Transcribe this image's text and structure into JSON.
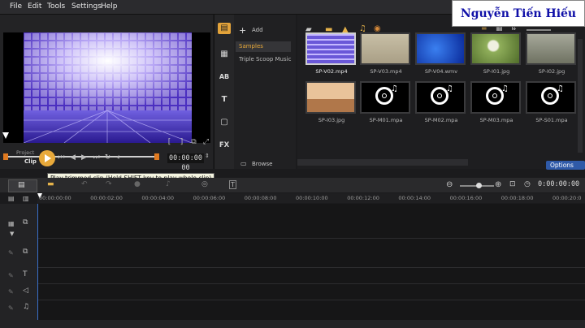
{
  "menu": [
    "File",
    "Edit",
    "Tools",
    "Settings",
    "Help"
  ],
  "watermark": "Nguyễn Tiến Hiếu",
  "preview": {
    "project_label": "Project",
    "clip_label": "Clip",
    "timecode": "00:00:00 00",
    "tooltip": "Play trimmed clip (Hold SHIFT key to play whole clip)"
  },
  "library": {
    "add_label": "Add",
    "folders": [
      "Samples",
      "Triple Scoop Music"
    ],
    "browse_label": "Browse",
    "options_label": "Options",
    "items": [
      {
        "label": "SP-V02.mp4",
        "kind": "video-tiles"
      },
      {
        "label": "SP-V03.mp4",
        "kind": "video-beige"
      },
      {
        "label": "SP-V04.wmv",
        "kind": "video-blue"
      },
      {
        "label": "SP-I01.jpg",
        "kind": "image-dandelion"
      },
      {
        "label": "SP-I02.jpg",
        "kind": "image-tree"
      },
      {
        "label": "SP-I03.jpg",
        "kind": "image-desert"
      },
      {
        "label": "SP-M01.mpa",
        "kind": "audio"
      },
      {
        "label": "SP-M02.mpa",
        "kind": "audio"
      },
      {
        "label": "SP-M03.mpa",
        "kind": "audio"
      },
      {
        "label": "SP-S01.mpa",
        "kind": "audio"
      }
    ]
  },
  "timeline": {
    "timecode": "0:00:00:00",
    "ruler": [
      "00:00:00:00",
      "00:00:02:00",
      "00:00:04:00",
      "00:00:06:00",
      "00:00:08:00",
      "00:00:10:00",
      "00:00:12:00",
      "00:00:14:00",
      "00:00:16:00",
      "00:00:18:00",
      "00:00:20:0"
    ]
  }
}
